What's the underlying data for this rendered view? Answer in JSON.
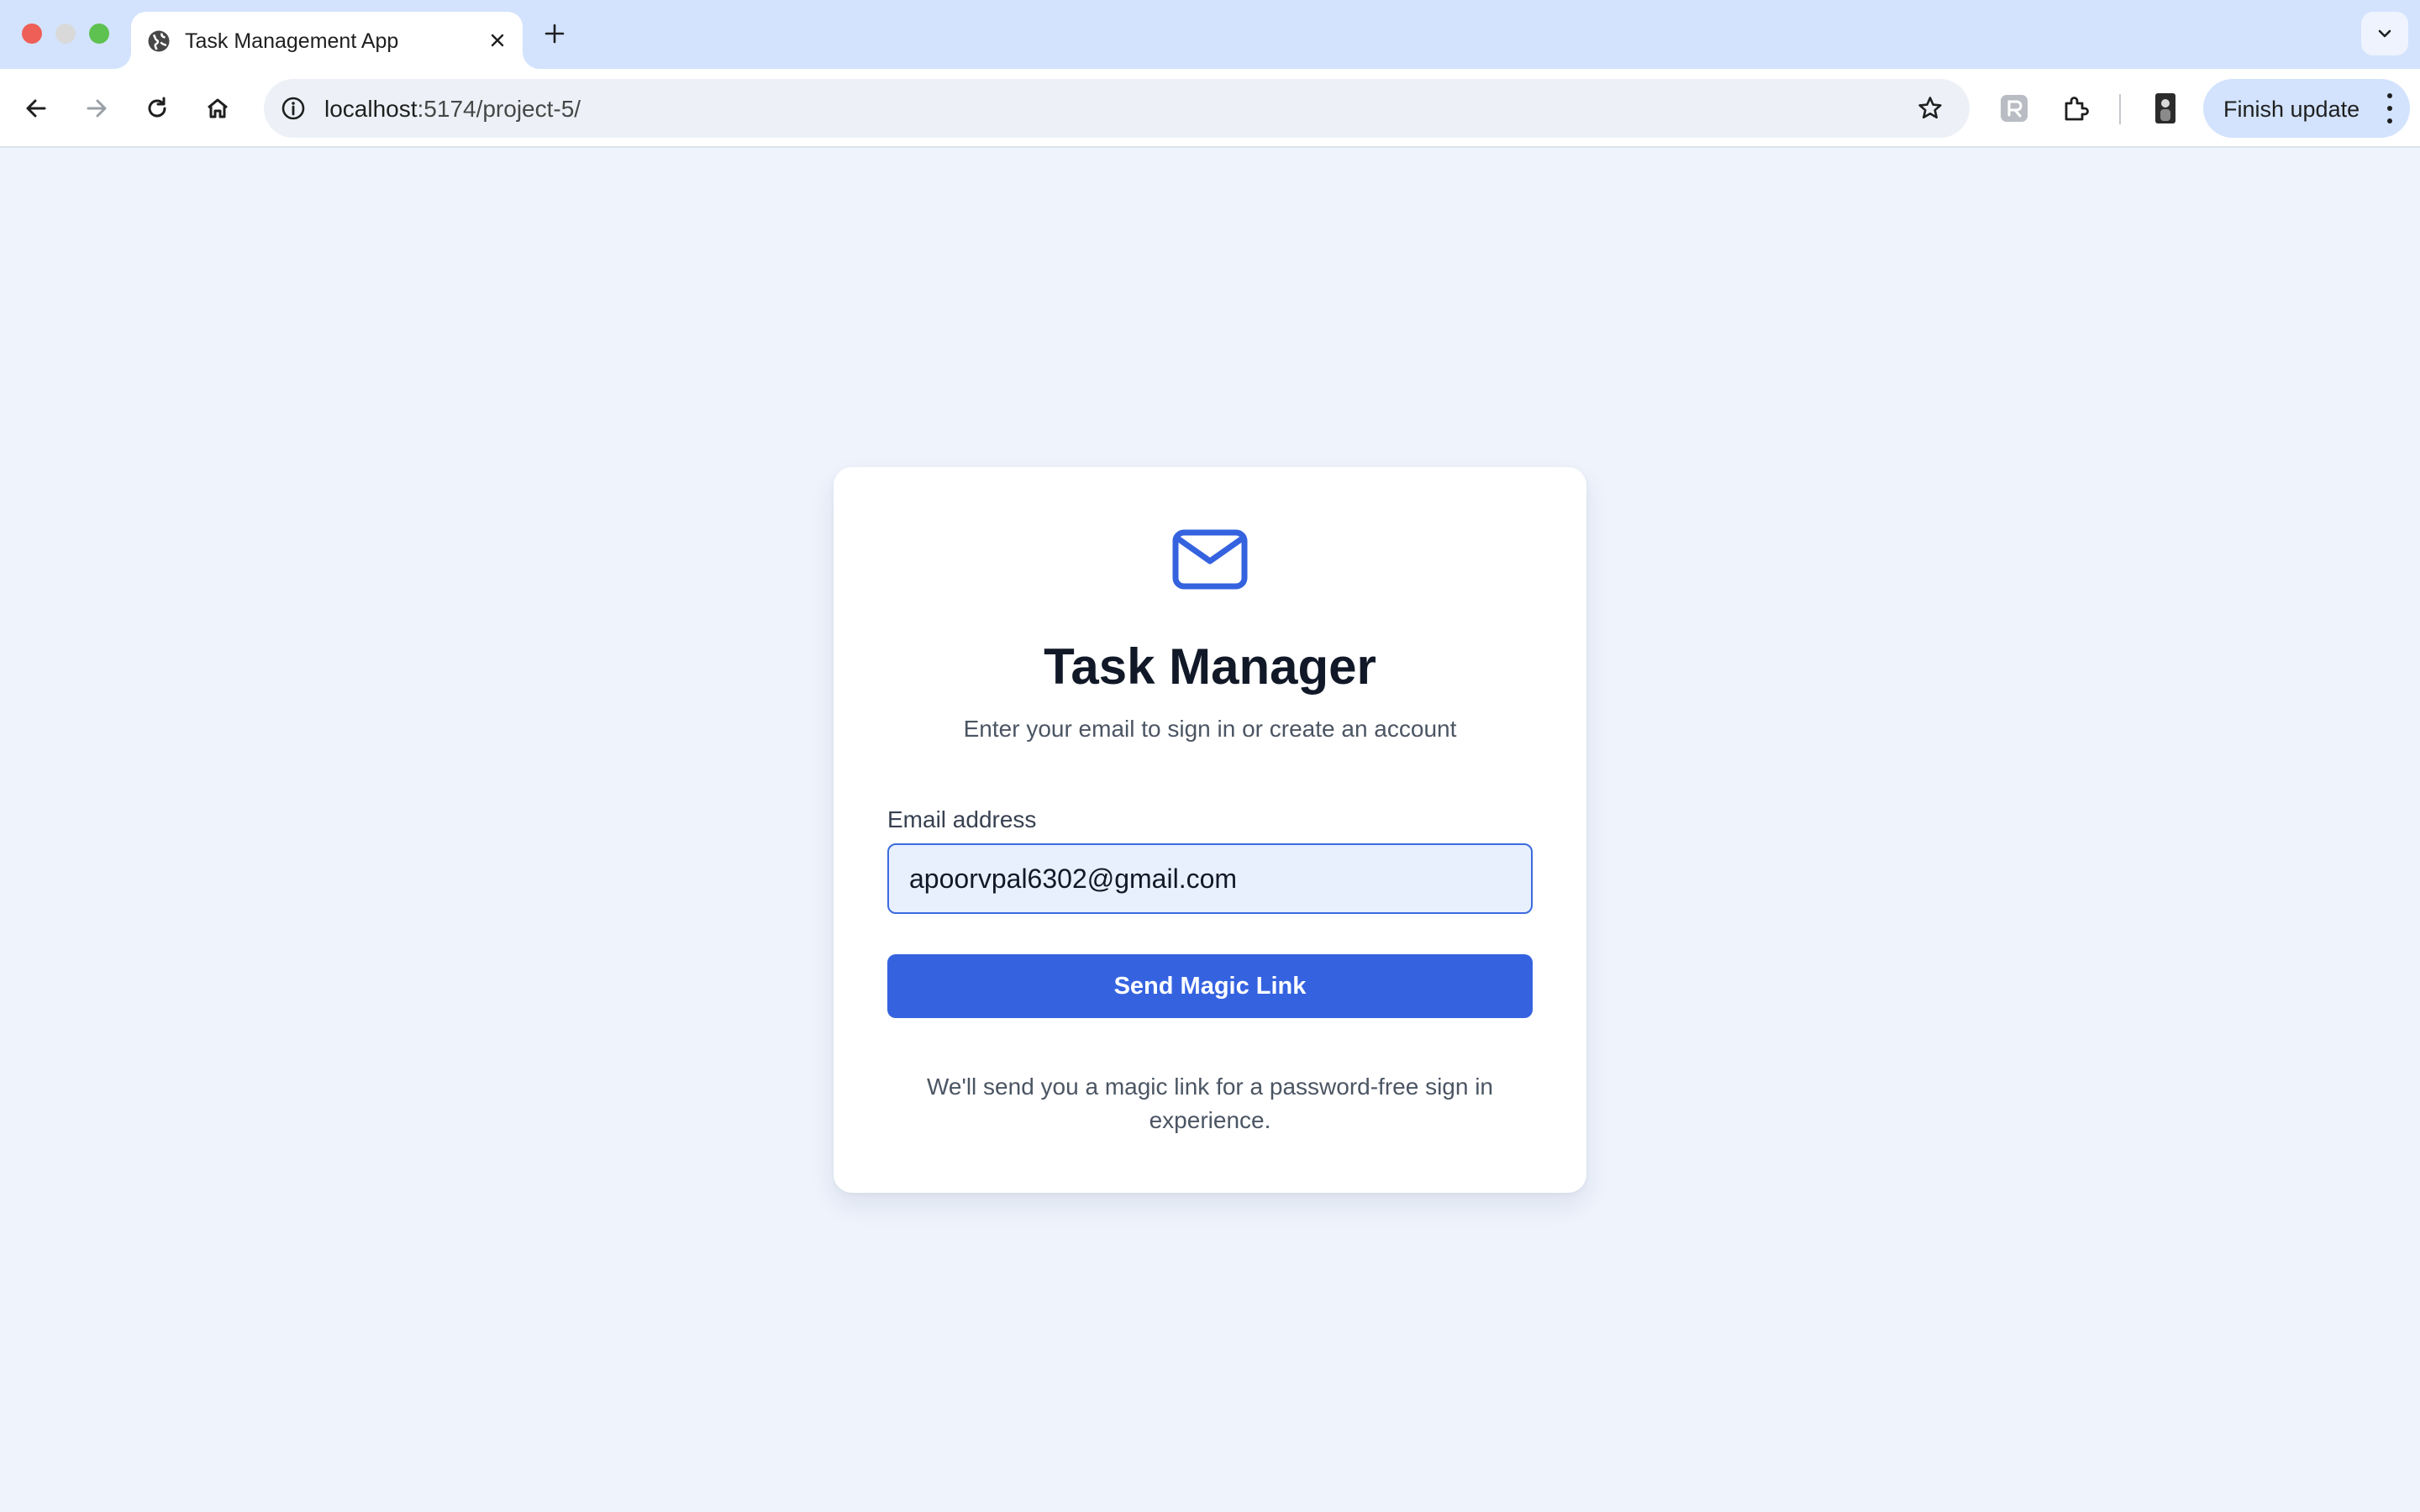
{
  "browser": {
    "tab": {
      "title": "Task Management App",
      "icon": "globe-icon"
    },
    "url": {
      "host": "localhost",
      "path": ":5174/project-5/"
    },
    "finish_update_label": "Finish update"
  },
  "login": {
    "icon": "mail-icon",
    "title": "Task Manager",
    "subtitle": "Enter your email to sign in or create an account",
    "email_label": "Email address",
    "email_value": "apoorvpal6302@gmail.com",
    "submit_label": "Send Magic Link",
    "helper_text": "We'll send you a magic link for a password-free sign in experience."
  },
  "colors": {
    "accent": "#3563e0",
    "page_background": "#eef3fc",
    "tabstrip": "#d3e3fd"
  }
}
